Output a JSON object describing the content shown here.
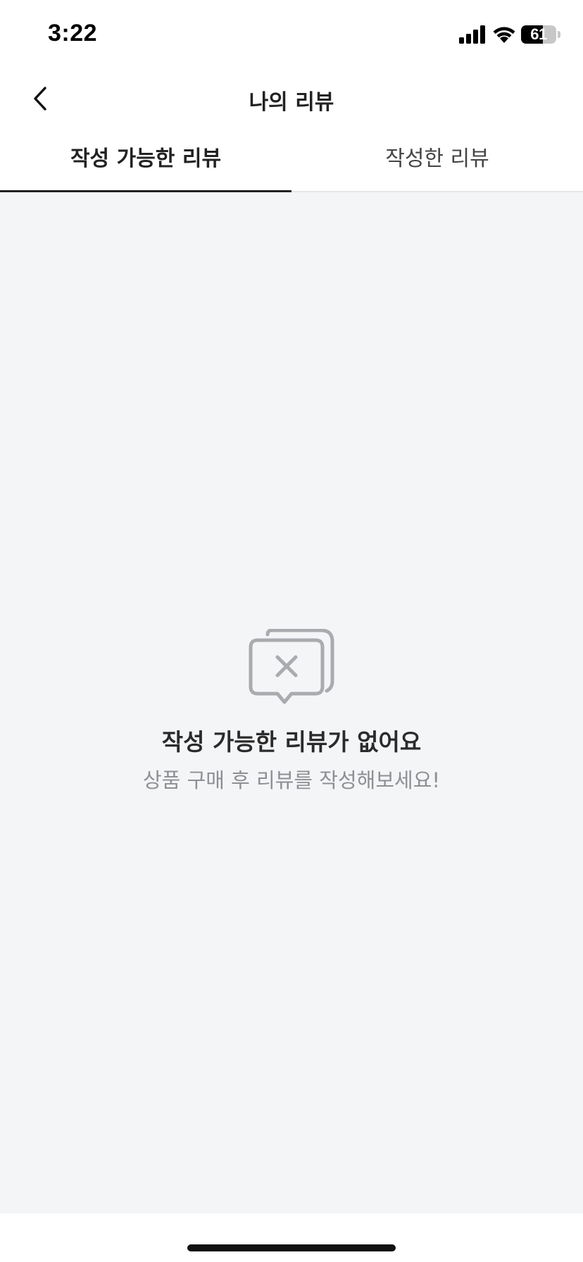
{
  "status_bar": {
    "time": "3:22",
    "battery_level": "61",
    "battery_fraction": 0.61
  },
  "nav": {
    "title": "나의 리뷰",
    "back_icon": "chevron-left-icon"
  },
  "tabs": [
    {
      "label": "작성 가능한 리뷰",
      "active": true
    },
    {
      "label": "작성한 리뷰",
      "active": false
    }
  ],
  "empty_state": {
    "icon": "chat-bubble-x-icon",
    "title": "작성 가능한 리뷰가 없어요",
    "subtitle": "상품 구매 후 리뷰를 작성해보세요!"
  },
  "colors": {
    "background": "#f4f5f7",
    "text_primary": "#222222",
    "text_secondary": "#8d8f93",
    "icon_gray": "#a9abaf"
  }
}
